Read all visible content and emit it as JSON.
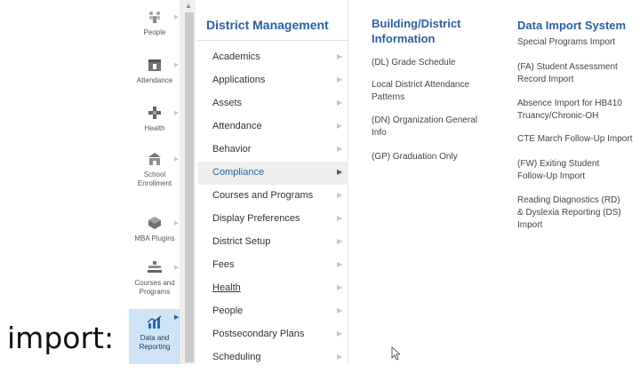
{
  "caption": "import:",
  "nav": [
    {
      "label": "People",
      "icon": "people-icon"
    },
    {
      "label": "Attendance",
      "icon": "attendance-icon"
    },
    {
      "label": "Health",
      "icon": "health-icon"
    },
    {
      "label": "School Enrollment",
      "icon": "school-icon"
    },
    {
      "label": "MBA Plugins",
      "icon": "plugin-icon"
    },
    {
      "label": "Courses and Programs",
      "icon": "courses-icon"
    },
    {
      "label": "Data and Reporting",
      "icon": "chart-icon"
    }
  ],
  "menu": {
    "title": "District Management",
    "items": [
      "Academics",
      "Applications",
      "Assets",
      "Attendance",
      "Behavior",
      "Compliance",
      "Courses and Programs",
      "Display Preferences",
      "District Setup",
      "Fees",
      "Health",
      "People",
      "Postsecondary Plans",
      "Scheduling"
    ],
    "selected": "Compliance",
    "hovered": "Health"
  },
  "building": {
    "title": "Building/District Information",
    "items": [
      "(DL) Grade Schedule",
      "Local District Attendance Patterns",
      "(DN) Organization General Info",
      "(GP) Graduation Only"
    ]
  },
  "import": {
    "title": "Data Import System",
    "items": [
      "Special Programs Import",
      "(FA) Student Assessment Record Import",
      "Absence Import for HB410 Truancy/Chronic-OH",
      "CTE March Follow-Up Import",
      "(FW) Exiting Student Follow-Up Import",
      "Reading Diagnostics (RD) & Dyslexia Reporting (DS) Import"
    ]
  },
  "colors": {
    "accent": "#2b5f9e",
    "active_bg": "#cfe4f7",
    "selected_bg": "#eeeeee"
  }
}
